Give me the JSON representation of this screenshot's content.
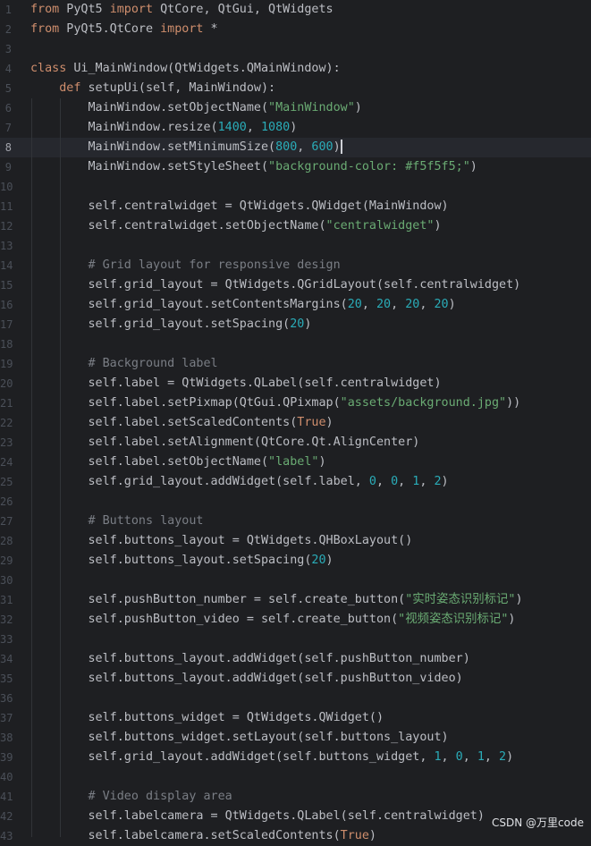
{
  "editor": {
    "current_line": 8,
    "lines": [
      {
        "n": "1",
        "tokens": [
          [
            "k",
            "from"
          ],
          [
            "t",
            " PyQt5 "
          ],
          [
            "k",
            "import"
          ],
          [
            "t",
            " QtCore, QtGui, QtWidgets"
          ]
        ]
      },
      {
        "n": "2",
        "tokens": [
          [
            "k",
            "from"
          ],
          [
            "t",
            " PyQt5.QtCore "
          ],
          [
            "k",
            "import"
          ],
          [
            "t",
            " *"
          ]
        ]
      },
      {
        "n": "3",
        "tokens": []
      },
      {
        "n": "4",
        "tokens": [
          [
            "k",
            "class"
          ],
          [
            "t",
            " Ui_MainWindow(QtWidgets.QMainWindow):"
          ]
        ]
      },
      {
        "n": "5",
        "tokens": [
          [
            "t",
            "    "
          ],
          [
            "k",
            "def"
          ],
          [
            "t",
            " setupUi(self, MainWindow):"
          ]
        ]
      },
      {
        "n": "6",
        "tokens": [
          [
            "t",
            "        MainWindow.setObjectName("
          ],
          [
            "s",
            "\"MainWindow\""
          ],
          [
            "t",
            ")"
          ]
        ]
      },
      {
        "n": "7",
        "tokens": [
          [
            "t",
            "        MainWindow.resize("
          ],
          [
            "n",
            "1400"
          ],
          [
            "t",
            ", "
          ],
          [
            "n",
            "1080"
          ],
          [
            "t",
            ")"
          ]
        ]
      },
      {
        "n": "8",
        "tokens": [
          [
            "t",
            "        MainWindow.setMinimumSize("
          ],
          [
            "n",
            "800"
          ],
          [
            "t",
            ", "
          ],
          [
            "n",
            "600"
          ],
          [
            "t",
            ")"
          ]
        ],
        "caret": true
      },
      {
        "n": "9",
        "tokens": [
          [
            "t",
            "        MainWindow.setStyleSheet("
          ],
          [
            "s",
            "\"background-color: #f5f5f5;\""
          ],
          [
            "t",
            ")"
          ]
        ]
      },
      {
        "n": "10",
        "tokens": []
      },
      {
        "n": "11",
        "tokens": [
          [
            "t",
            "        self.centralwidget = QtWidgets.QWidget(MainWindow)"
          ]
        ]
      },
      {
        "n": "12",
        "tokens": [
          [
            "t",
            "        self.centralwidget.setObjectName("
          ],
          [
            "s",
            "\"centralwidget\""
          ],
          [
            "t",
            ")"
          ]
        ]
      },
      {
        "n": "13",
        "tokens": []
      },
      {
        "n": "14",
        "tokens": [
          [
            "c",
            "        # Grid layout for responsive design"
          ]
        ]
      },
      {
        "n": "15",
        "tokens": [
          [
            "t",
            "        self.grid_layout = QtWidgets.QGridLayout(self.centralwidget)"
          ]
        ]
      },
      {
        "n": "16",
        "tokens": [
          [
            "t",
            "        self.grid_layout.setContentsMargins("
          ],
          [
            "n",
            "20"
          ],
          [
            "t",
            ", "
          ],
          [
            "n",
            "20"
          ],
          [
            "t",
            ", "
          ],
          [
            "n",
            "20"
          ],
          [
            "t",
            ", "
          ],
          [
            "n",
            "20"
          ],
          [
            "t",
            ")"
          ]
        ]
      },
      {
        "n": "17",
        "tokens": [
          [
            "t",
            "        self.grid_layout.setSpacing("
          ],
          [
            "n",
            "20"
          ],
          [
            "t",
            ")"
          ]
        ]
      },
      {
        "n": "18",
        "tokens": []
      },
      {
        "n": "19",
        "tokens": [
          [
            "c",
            "        # Background label"
          ]
        ]
      },
      {
        "n": "20",
        "tokens": [
          [
            "t",
            "        self.label = QtWidgets.QLabel(self.centralwidget)"
          ]
        ]
      },
      {
        "n": "21",
        "tokens": [
          [
            "t",
            "        self.label.setPixmap(QtGui.QPixmap("
          ],
          [
            "s",
            "\"assets/background.jpg\""
          ],
          [
            "t",
            "))"
          ]
        ]
      },
      {
        "n": "22",
        "tokens": [
          [
            "t",
            "        self.label.setScaledContents("
          ],
          [
            "k",
            "True"
          ],
          [
            "t",
            ")"
          ]
        ]
      },
      {
        "n": "23",
        "tokens": [
          [
            "t",
            "        self.label.setAlignment(QtCore.Qt.AlignCenter)"
          ]
        ]
      },
      {
        "n": "24",
        "tokens": [
          [
            "t",
            "        self.label.setObjectName("
          ],
          [
            "s",
            "\"label\""
          ],
          [
            "t",
            ")"
          ]
        ]
      },
      {
        "n": "25",
        "tokens": [
          [
            "t",
            "        self.grid_layout.addWidget(self.label, "
          ],
          [
            "n",
            "0"
          ],
          [
            "t",
            ", "
          ],
          [
            "n",
            "0"
          ],
          [
            "t",
            ", "
          ],
          [
            "n",
            "1"
          ],
          [
            "t",
            ", "
          ],
          [
            "n",
            "2"
          ],
          [
            "t",
            ")"
          ]
        ]
      },
      {
        "n": "26",
        "tokens": []
      },
      {
        "n": "27",
        "tokens": [
          [
            "c",
            "        # Buttons layout"
          ]
        ]
      },
      {
        "n": "28",
        "tokens": [
          [
            "t",
            "        self.buttons_layout = QtWidgets.QHBoxLayout()"
          ]
        ]
      },
      {
        "n": "29",
        "tokens": [
          [
            "t",
            "        self.buttons_layout.setSpacing("
          ],
          [
            "n",
            "20"
          ],
          [
            "t",
            ")"
          ]
        ]
      },
      {
        "n": "30",
        "tokens": []
      },
      {
        "n": "31",
        "tokens": [
          [
            "t",
            "        self.pushButton_number = self.create_button("
          ],
          [
            "s",
            "\"实时姿态识别标记\""
          ],
          [
            "t",
            ")"
          ]
        ]
      },
      {
        "n": "32",
        "tokens": [
          [
            "t",
            "        self.pushButton_video = self.create_button("
          ],
          [
            "s",
            "\"视频姿态识别标记\""
          ],
          [
            "t",
            ")"
          ]
        ]
      },
      {
        "n": "33",
        "tokens": []
      },
      {
        "n": "34",
        "tokens": [
          [
            "t",
            "        self.buttons_layout.addWidget(self.pushButton_number)"
          ]
        ]
      },
      {
        "n": "35",
        "tokens": [
          [
            "t",
            "        self.buttons_layout.addWidget(self.pushButton_video)"
          ]
        ]
      },
      {
        "n": "36",
        "tokens": []
      },
      {
        "n": "37",
        "tokens": [
          [
            "t",
            "        self.buttons_widget = QtWidgets.QWidget()"
          ]
        ]
      },
      {
        "n": "38",
        "tokens": [
          [
            "t",
            "        self.buttons_widget.setLayout(self.buttons_layout)"
          ]
        ]
      },
      {
        "n": "39",
        "tokens": [
          [
            "t",
            "        self.grid_layout.addWidget(self.buttons_widget, "
          ],
          [
            "n",
            "1"
          ],
          [
            "t",
            ", "
          ],
          [
            "n",
            "0"
          ],
          [
            "t",
            ", "
          ],
          [
            "n",
            "1"
          ],
          [
            "t",
            ", "
          ],
          [
            "n",
            "2"
          ],
          [
            "t",
            ")"
          ]
        ]
      },
      {
        "n": "40",
        "tokens": []
      },
      {
        "n": "41",
        "tokens": [
          [
            "c",
            "        # Video display area"
          ]
        ]
      },
      {
        "n": "42",
        "tokens": [
          [
            "t",
            "        self.labelcamera = QtWidgets.QLabel(self.centralwidget)"
          ]
        ]
      },
      {
        "n": "43",
        "tokens": [
          [
            "t",
            "        self.labelcamera.setScaledContents("
          ],
          [
            "k",
            "True"
          ],
          [
            "t",
            ")"
          ]
        ]
      }
    ]
  },
  "watermark": "CSDN @万里code",
  "colors": {
    "background": "#1e1f22",
    "current_line": "#26282e",
    "keyword": "#cf8e6d",
    "string": "#6aab73",
    "number": "#2aacb8",
    "comment": "#7a7e85",
    "text": "#bcbec4",
    "line_number": "#4b5059"
  }
}
